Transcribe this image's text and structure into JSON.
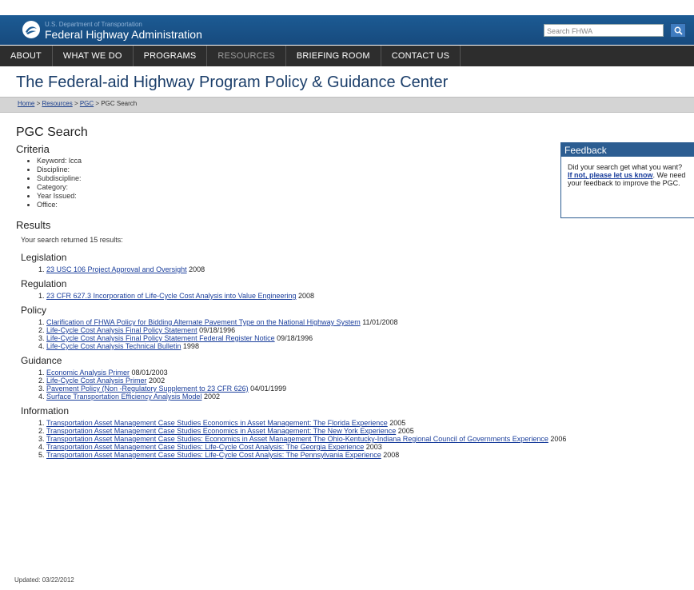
{
  "header": {
    "agency_small": "U.S. Department of Transportation",
    "agency_big": "Federal Highway Administration",
    "search_placeholder": "Search FHWA"
  },
  "nav": {
    "items": [
      {
        "label": "ABOUT"
      },
      {
        "label": "WHAT WE DO"
      },
      {
        "label": "PROGRAMS"
      },
      {
        "label": "RESOURCES"
      },
      {
        "label": "BRIEFING ROOM"
      },
      {
        "label": "CONTACT US"
      }
    ]
  },
  "page": {
    "title": "The Federal-aid Highway Program Policy & Guidance Center",
    "heading": "PGC Search",
    "updated": "Updated: 03/22/2012"
  },
  "breadcrumb": {
    "home": "Home",
    "sep1": " > ",
    "resources": "Resources",
    "sep2": " > ",
    "pgc": "PGC",
    "sep3": " > ",
    "current": "PGC Search"
  },
  "criteria": {
    "heading": "Criteria",
    "items": [
      "Keyword: lcca",
      "Discipline:",
      "Subdiscipline:",
      "Category:",
      "Year Issued:",
      "Office:"
    ]
  },
  "results": {
    "heading": "Results",
    "count_text": "Your search returned 15 results:",
    "categories": [
      {
        "name": "Legislation",
        "items": [
          {
            "title": "23 USC 106 Project Approval and Oversight",
            "date": " 2008"
          }
        ]
      },
      {
        "name": "Regulation",
        "items": [
          {
            "title": "23 CFR 627.3 Incorporation of Life-Cycle Cost Analysis into Value Engineering",
            "date": " 2008"
          }
        ]
      },
      {
        "name": "Policy",
        "items": [
          {
            "title": "Clarification of FHWA Policy for Bidding Alternate Pavement Type on the National Highway System",
            "date": " 11/01/2008"
          },
          {
            "title": "Life-Cycle Cost Analysis Final Policy Statement",
            "date": " 09/18/1996"
          },
          {
            "title": "Life-Cycle Cost Analysis Final Policy Statement Federal Register Notice",
            "date": " 09/18/1996"
          },
          {
            "title": "Life-Cycle Cost Analysis Technical Bulletin",
            "date": " 1998"
          }
        ]
      },
      {
        "name": "Guidance",
        "items": [
          {
            "title": "Economic Analysis Primer",
            "date": " 08/01/2003"
          },
          {
            "title": "Life-Cycle Cost Analysis Primer",
            "date": " 2002"
          },
          {
            "title": "Pavement Policy (Non -Regulatory Supplement to 23 CFR 626)",
            "date": " 04/01/1999"
          },
          {
            "title": "Surface Transportation Efficiency Analysis Model",
            "date": " 2002"
          }
        ]
      },
      {
        "name": "Information",
        "items": [
          {
            "title": "Transportation Asset Management Case Studies Economics in Asset Management: The Florida Experience",
            "date": " 2005"
          },
          {
            "title": "Transportation Asset Management Case Studies Economics in Asset Management: The New York Experience",
            "date": " 2005"
          },
          {
            "title": "Transportation Asset Management Case Studies: Economics in Asset Management The Ohio-Kentucky-Indiana Regional Council of Governments Experience",
            "date": " 2006"
          },
          {
            "title": "Transportation Asset Management Case Studies: Life-Cycle Cost Analysis: The Georgia Experience",
            "date": " 2003"
          },
          {
            "title": "Transportation Asset Management Case Studies: Life-Cycle Cost Analysis: The Pennsylvania Experience",
            "date": " 2008"
          }
        ]
      }
    ]
  },
  "feedback": {
    "heading": "Feedback",
    "text_before": "Did your search get what you want? ",
    "link": "If not, please let us know",
    "text_after": ". We need your feedback to improve the PGC."
  }
}
